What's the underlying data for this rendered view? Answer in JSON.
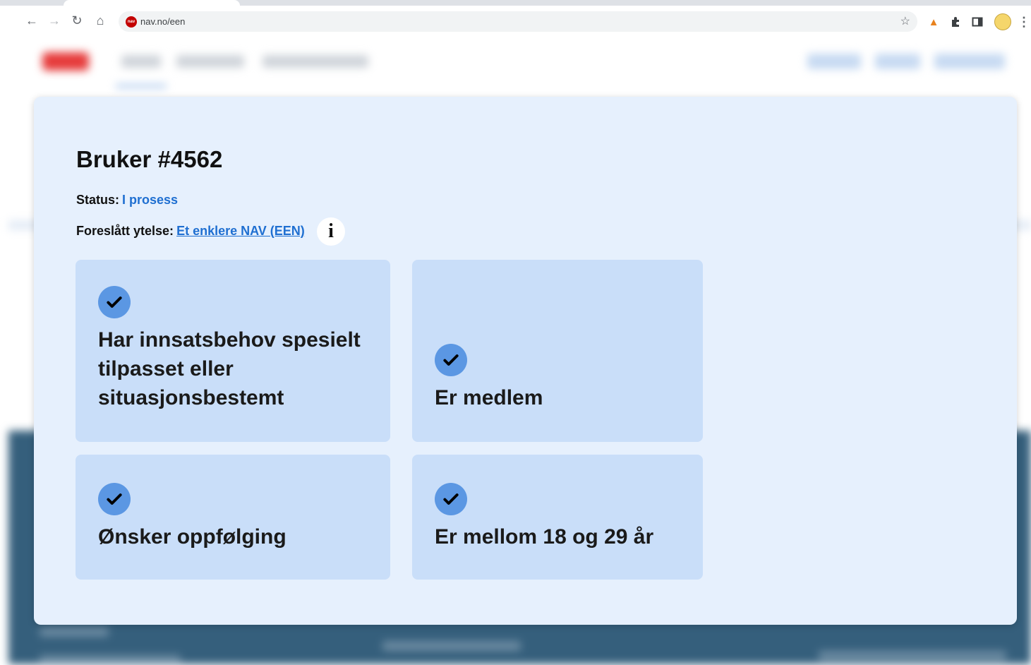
{
  "browser": {
    "url": "nav.no/een",
    "site_icon_text": "nav"
  },
  "modal": {
    "title": "Bruker #4562",
    "status_label": "Status:",
    "status_value": "I prosess",
    "benefit_label": "Foreslått ytelse:",
    "benefit_link": "Et enklere NAV (EEN)",
    "info_glyph": "i",
    "criteria": [
      {
        "text": "Har innsatsbehov spesielt tilpasset eller situasjonsbestemt",
        "met": true
      },
      {
        "text": "Er medlem",
        "met": true
      },
      {
        "text": "Ønsker oppfølging",
        "met": true
      },
      {
        "text": "Er mellom 18 og 29 år",
        "met": true
      }
    ]
  }
}
